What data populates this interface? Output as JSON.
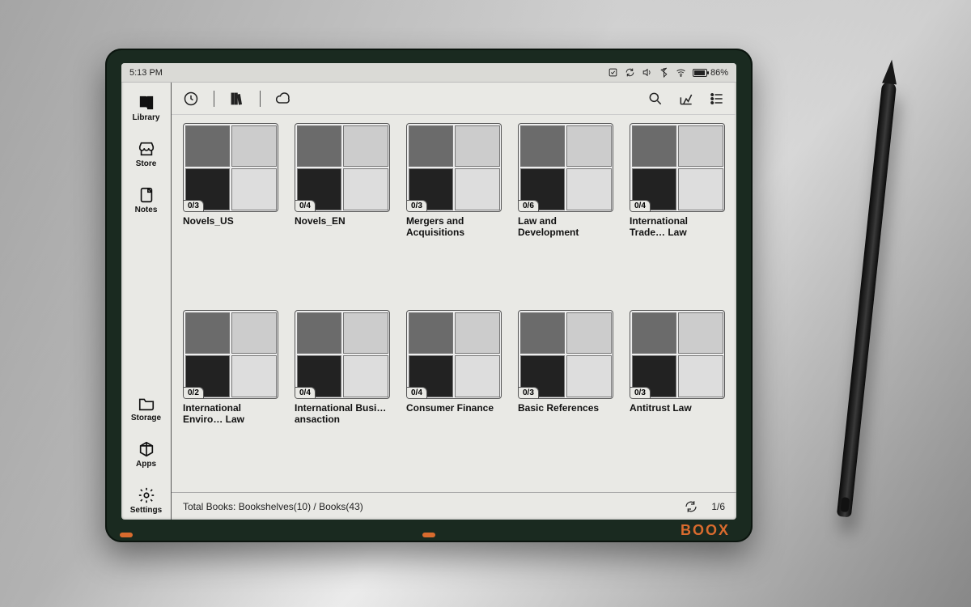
{
  "brand": "BOOX",
  "status": {
    "time": "5:13 PM",
    "battery_text": "86%"
  },
  "sidebar": {
    "items": [
      {
        "label": "Library"
      },
      {
        "label": "Store"
      },
      {
        "label": "Notes"
      },
      {
        "label": "Storage"
      },
      {
        "label": "Apps"
      },
      {
        "label": "Settings"
      }
    ]
  },
  "shelves": [
    {
      "title": "Novels_US",
      "badge": "0/3"
    },
    {
      "title": "Novels_EN",
      "badge": "0/4"
    },
    {
      "title": "Mergers and Acquisitions",
      "badge": "0/3"
    },
    {
      "title": "Law and Development",
      "badge": "0/6"
    },
    {
      "title": "International Trade… Law",
      "badge": "0/4"
    },
    {
      "title": "International Enviro… Law",
      "badge": "0/2"
    },
    {
      "title": "International Busi…ansaction",
      "badge": "0/4"
    },
    {
      "title": "Consumer Finance",
      "badge": "0/4"
    },
    {
      "title": "Basic References",
      "badge": "0/3"
    },
    {
      "title": "Antitrust Law",
      "badge": "0/3"
    }
  ],
  "footer": {
    "summary": "Total Books: Bookshelves(10) / Books(43)",
    "page": "1/6"
  }
}
